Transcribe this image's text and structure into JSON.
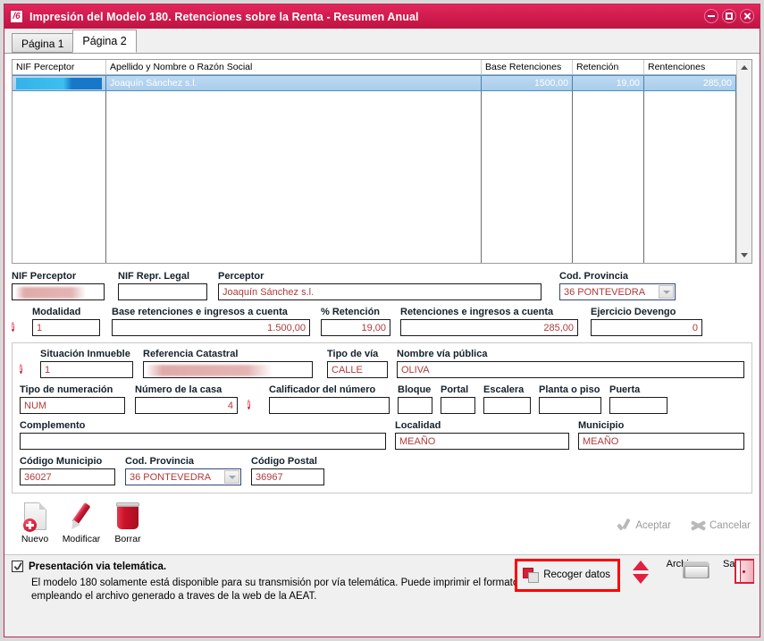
{
  "window": {
    "title": "Impresión del Modelo 180. Retenciones sobre la Renta - Resumen Anual",
    "app_icon_text": "/6",
    "minimize_label": "Minimizar",
    "maximize_label": "Maximizar",
    "close_label": "Cerrar"
  },
  "tabs": [
    {
      "label": "Página 1",
      "active": false
    },
    {
      "label": "Página 2",
      "active": true
    }
  ],
  "grid": {
    "columns": [
      "NIF Perceptor",
      "Apellido y Nombre o Razón Social",
      "Base Retenciones",
      "Retención",
      "Rentenciones"
    ],
    "rows": [
      {
        "nif": "",
        "nif_redacted": true,
        "nombre": "Joaquín Sánchez s.l.",
        "base_retenciones": "1500,00",
        "retencion": "19,00",
        "retenciones": "285,00",
        "selected": true
      }
    ]
  },
  "form": {
    "nif_perceptor": {
      "label": "NIF Perceptor",
      "value": "",
      "redacted": true
    },
    "nif_repr_legal": {
      "label": "NIF Repr. Legal",
      "value": ""
    },
    "perceptor": {
      "label": "Perceptor",
      "value": "Joaquín Sánchez s.l."
    },
    "cod_provincia_top": {
      "label": "Cod. Provincia",
      "value": "36  PONTEVEDRA"
    },
    "modalidad": {
      "label": "Modalidad",
      "value": "1"
    },
    "base_retenciones": {
      "label": "Base retenciones e ingresos a cuenta",
      "value": "1.500,00"
    },
    "pct_retencion": {
      "label": "% Retención",
      "value": "19,00"
    },
    "retenciones_ingresos": {
      "label": "Retenciones e ingresos a cuenta",
      "value": "285,00"
    },
    "ejercicio_devengo": {
      "label": "Ejercicio Devengo",
      "value": "0"
    },
    "situacion_inmueble": {
      "label": "Situación Inmueble",
      "value": "1"
    },
    "referencia_catastral": {
      "label": "Referencia Catastral",
      "value": "",
      "redacted": true
    },
    "tipo_de_via": {
      "label": "Tipo de vía",
      "value": "CALLE"
    },
    "nombre_via_publica": {
      "label": "Nombre vía pública",
      "value": "OLIVA"
    },
    "tipo_numeracion": {
      "label": "Tipo de numeración",
      "value": "NUM"
    },
    "numero_casa": {
      "label": "Número de la casa",
      "value": "4"
    },
    "calificador_numero": {
      "label": "Calificador del número",
      "value": ""
    },
    "bloque": {
      "label": "Bloque",
      "value": ""
    },
    "portal": {
      "label": "Portal",
      "value": ""
    },
    "escalera": {
      "label": "Escalera",
      "value": ""
    },
    "planta_piso": {
      "label": "Planta o piso",
      "value": ""
    },
    "puerta": {
      "label": "Puerta",
      "value": ""
    },
    "complemento": {
      "label": "Complemento",
      "value": ""
    },
    "localidad": {
      "label": "Localidad",
      "value": "MEAÑO"
    },
    "municipio": {
      "label": "Municipio",
      "value": "MEAÑO"
    },
    "codigo_municipio": {
      "label": "Código Municipio",
      "value": "36027"
    },
    "cod_provincia": {
      "label": "Cod. Provincia",
      "value": "36  PONTEVEDRA"
    },
    "codigo_postal": {
      "label": "Código Postal",
      "value": "36967"
    },
    "info_icon_text": "i"
  },
  "actions": {
    "nuevo": "Nuevo",
    "modificar": "Modificar",
    "borrar": "Borrar",
    "aceptar": "Aceptar",
    "cancelar": "Cancelar"
  },
  "bottom": {
    "checkbox_label": "Presentación via telemática.",
    "checkbox_checked": true,
    "description": "El modelo 180 solamente está disponible para su transmisión por vía telemática. Puede imprimir el formato oficial empleando el archivo generado a traves de la web de la AEAT.",
    "recoger_datos": "Recoger datos",
    "archivo": "Archivo",
    "salir": "Salir",
    "highlight_color": "#ff0000"
  },
  "colors": {
    "titlebar": "#d11d4f",
    "field_text": "#b03a3a",
    "selection": "#a9cdec",
    "accent_red": "#d81e37"
  }
}
